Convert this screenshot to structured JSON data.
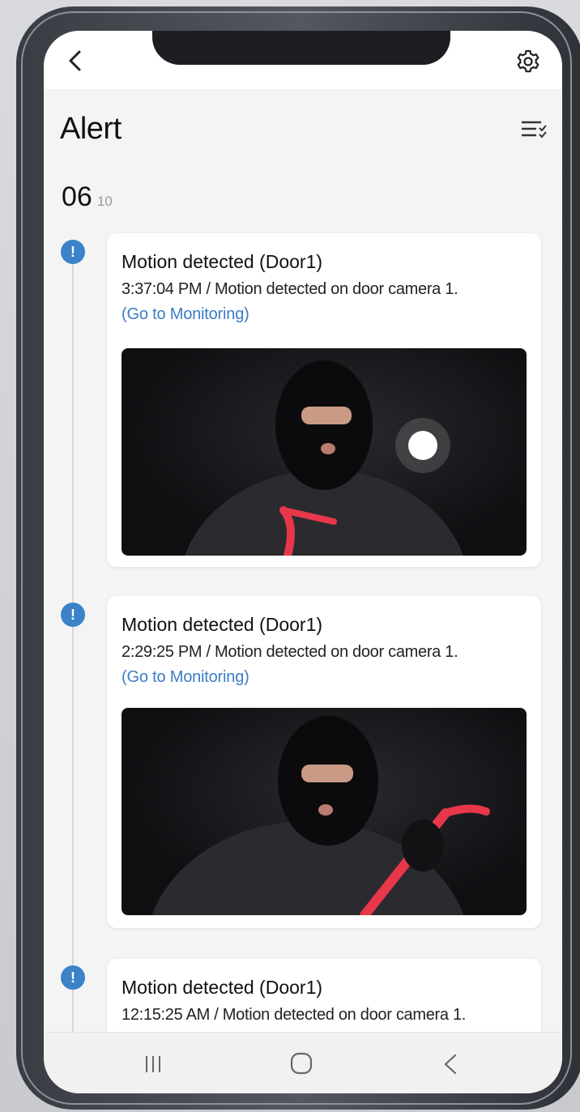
{
  "header": {
    "title": "Alert",
    "back_icon": "chevron-left-icon",
    "settings_icon": "gear-icon",
    "filter_icon": "filter-list-icon"
  },
  "date": {
    "day": "06",
    "month": "10"
  },
  "alerts": [
    {
      "title": "Motion detected (Door1)",
      "description": "3:37:04 PM / Motion detected on door camera 1.",
      "link": "(Go to Monitoring)",
      "image_icon": "camera-snapshot-image"
    },
    {
      "title": "Motion detected (Door1)",
      "description": "2:29:25 PM / Motion detected on door camera 1.",
      "link": "(Go to Monitoring)",
      "image_icon": "camera-snapshot-image"
    },
    {
      "title": "Motion detected (Door1)",
      "description": "12:15:25 AM / Motion detected on door camera 1."
    }
  ],
  "navbar": {
    "recents_icon": "recent-apps-icon",
    "home_icon": "home-icon",
    "back_icon": "back-icon"
  },
  "colors": {
    "accent": "#3b82c9",
    "link": "#3b7dc4",
    "screen_bg": "#f4f4f5"
  }
}
